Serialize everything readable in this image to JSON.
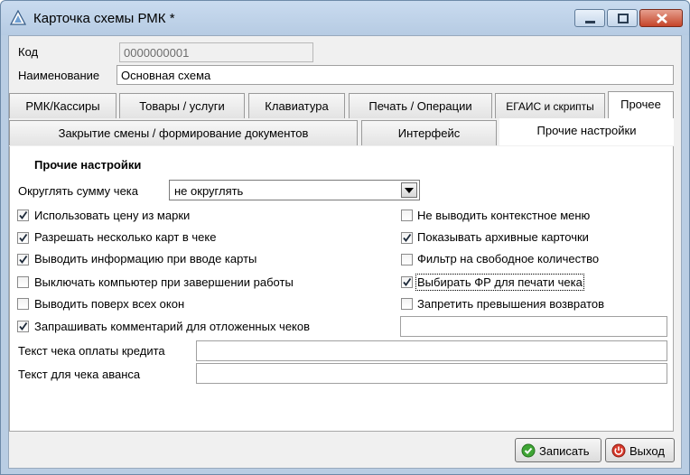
{
  "window": {
    "title": "Карточка схемы РМК *"
  },
  "header": {
    "code_label": "Код",
    "code_value": "0000000001",
    "name_label": "Наименование",
    "name_value": "Основная схема"
  },
  "tabs_row1": [
    {
      "label": "РМК/Кассиры",
      "active": false
    },
    {
      "label": "Товары / услуги",
      "active": false
    },
    {
      "label": "Клавиатура",
      "active": false
    },
    {
      "label": "Печать / Операции",
      "active": false
    },
    {
      "label": "ЕГАИС и скрипты",
      "active": false
    },
    {
      "label": "Прочее",
      "active": true
    }
  ],
  "tabs_row2": [
    {
      "label": "Закрытие смены / формирование документов",
      "active": false
    },
    {
      "label": "Интерфейс",
      "active": false
    },
    {
      "label": "Прочие настройки",
      "active": true
    }
  ],
  "panel": {
    "section_title": "Прочие настройки",
    "rounding_label": "Округлять сумму чека",
    "rounding_value": "не округлять",
    "checkboxes_left": [
      {
        "label": "Использовать цену из марки",
        "checked": true
      },
      {
        "label": "Разрешать несколько карт в чеке",
        "checked": true
      },
      {
        "label": "Выводить информацию при вводе карты",
        "checked": true
      },
      {
        "label": "Выключать компьютер при завершении работы",
        "checked": false
      },
      {
        "label": "Выводить поверх всех окон",
        "checked": false
      },
      {
        "label": "Запрашивать комментарий для отложенных чеков",
        "checked": true
      }
    ],
    "checkboxes_right": [
      {
        "label": "Не выводить контекстное меню",
        "checked": false
      },
      {
        "label": "Показывать архивные карточки",
        "checked": true
      },
      {
        "label": "Фильтр на свободное количество",
        "checked": false
      },
      {
        "label": "Выбирать ФР для печати чека",
        "checked": true
      },
      {
        "label": "Запретить превышения возвратов",
        "checked": false
      }
    ],
    "comment_value": "",
    "credit_label": "Текст чека оплаты кредита",
    "credit_value": "",
    "advance_label": "Текст для чека аванса",
    "advance_value": ""
  },
  "buttons": {
    "save_label": "Записать",
    "exit_label": "Выход"
  }
}
